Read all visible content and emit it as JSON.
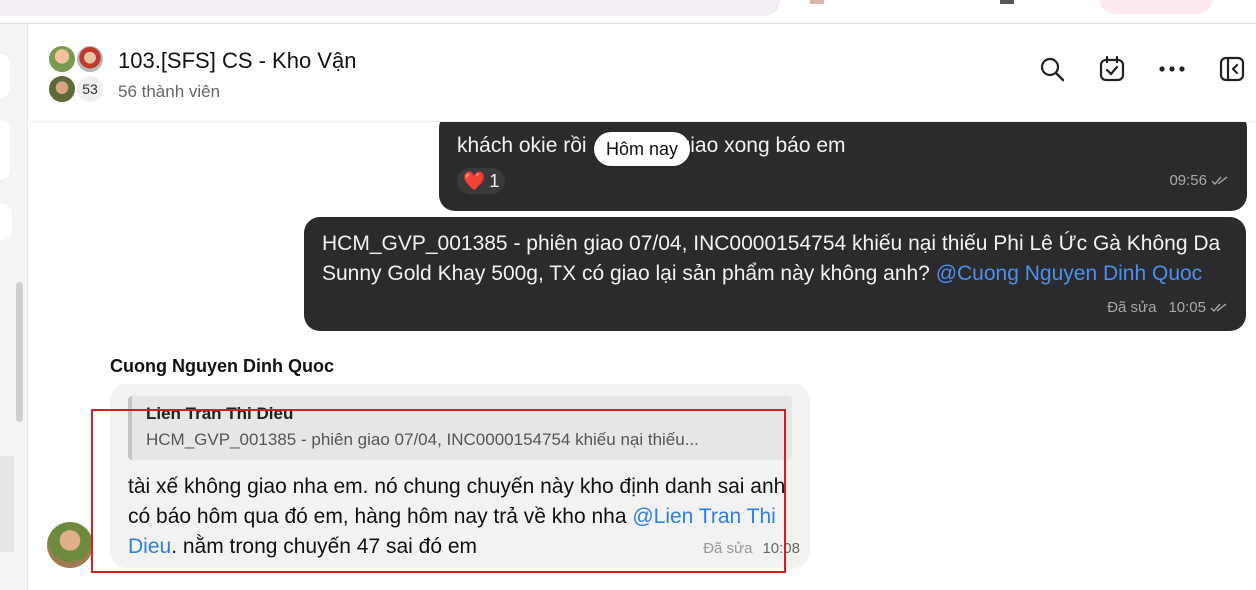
{
  "header": {
    "title": "103.[SFS] CS - Kho Vận",
    "member_count": "56 thành viên",
    "avatar_more_count": "53"
  },
  "date_pill": "Hôm nay",
  "messages": [
    {
      "text": "khách okie rồi, giao xong báo em",
      "text_before_pill": "khách okie rồi",
      "text_after_pill": "giao xong báo em",
      "reaction_emoji": "❤️",
      "reaction_count": "1",
      "time": "09:56"
    },
    {
      "text": "HCM_GVP_001385 - phiên giao 07/04, INC0000154754 khiếu nại thiếu Phi Lê Ức Gà Không Da Sunny Gold Khay 500g, TX có giao lại sản phẩm này không anh? ",
      "mention": "@Cuong Nguyen Dinh Quoc",
      "edited": "Đã sửa",
      "time": "10:05"
    },
    {
      "sender": "Cuong Nguyen Dinh Quoc",
      "quote_name": "Lien Tran Thi Dieu",
      "quote_text": "HCM_GVP_001385 - phiên giao 07/04, INC0000154754 khiếu nại thiếu...",
      "text_part1": "tài xế không giao nha em. nó chung chuyến này kho định danh sai anh có báo hôm qua đó em, hàng hôm nay trả về kho nha ",
      "mention": "@Lien Tran Thi Dieu",
      "text_part2": ". nằm trong chuyến 47 sai đó em",
      "edited": "Đã sửa",
      "time": "10:08"
    }
  ],
  "icons": {
    "search": "search-icon",
    "tasks": "calendar-check-icon",
    "more": "more-icon",
    "panel": "toggle-panel-icon",
    "read": "double-check-icon"
  },
  "colors": {
    "dark_bubble": "#2b2b2d",
    "light_bubble": "#f2f2f2",
    "mention_on_dark": "#4b8ff0",
    "mention_on_light": "#2f7fe0",
    "highlight_border": "#d21f26"
  }
}
